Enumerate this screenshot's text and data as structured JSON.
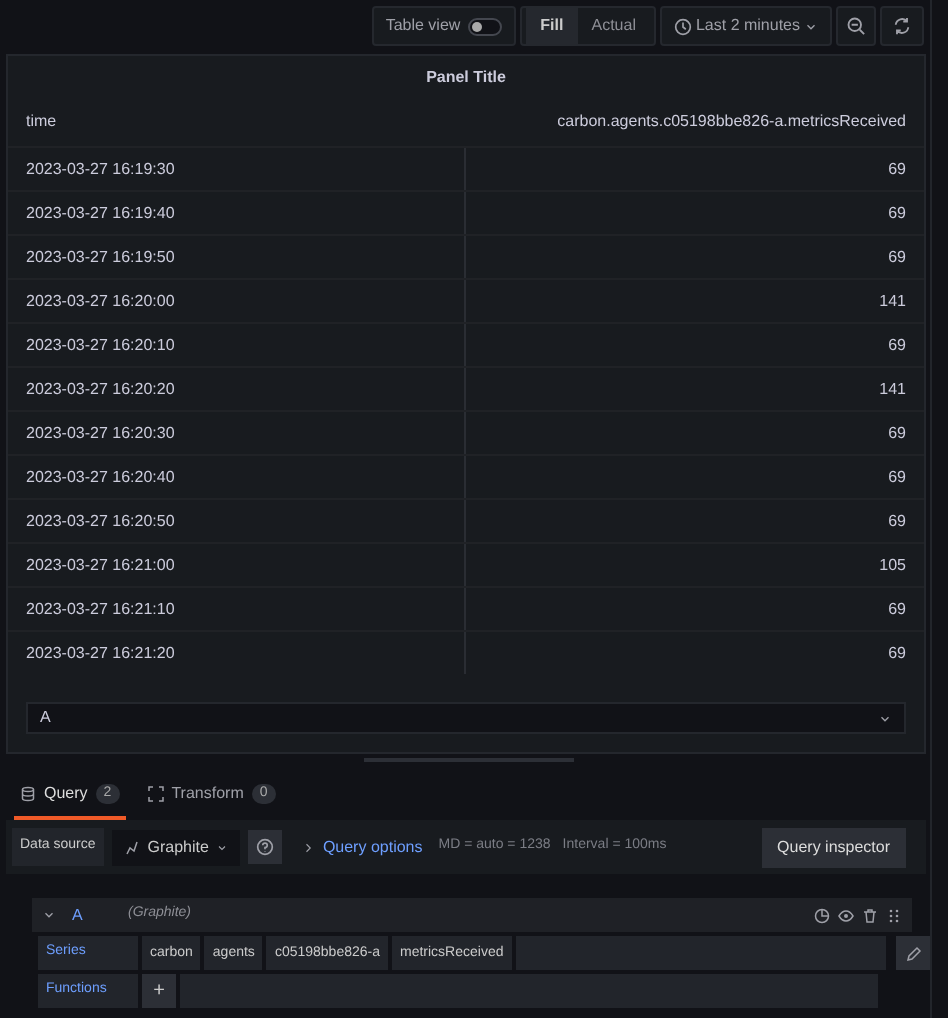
{
  "toolbar": {
    "table_view": {
      "label": "Table view",
      "on": false
    },
    "fill_modes": [
      {
        "label": "Fill",
        "selected": true
      },
      {
        "label": "Actual",
        "selected": false
      }
    ],
    "time_range": "Last 2 minutes"
  },
  "panel": {
    "title": "Panel Title",
    "columns": [
      "time",
      "carbon.agents.c05198bbe826-a.metricsReceived"
    ],
    "rows": [
      [
        "2023-03-27 16:19:30",
        "69"
      ],
      [
        "2023-03-27 16:19:40",
        "69"
      ],
      [
        "2023-03-27 16:19:50",
        "69"
      ],
      [
        "2023-03-27 16:20:00",
        "141"
      ],
      [
        "2023-03-27 16:20:10",
        "69"
      ],
      [
        "2023-03-27 16:20:20",
        "141"
      ],
      [
        "2023-03-27 16:20:30",
        "69"
      ],
      [
        "2023-03-27 16:20:40",
        "69"
      ],
      [
        "2023-03-27 16:20:50",
        "69"
      ],
      [
        "2023-03-27 16:21:00",
        "105"
      ],
      [
        "2023-03-27 16:21:10",
        "69"
      ],
      [
        "2023-03-27 16:21:20",
        "69"
      ]
    ],
    "frame_select": "A"
  },
  "query_tabs": [
    {
      "label": "Query",
      "count": "2",
      "selected": true
    },
    {
      "label": "Transform",
      "count": "0",
      "selected": false
    }
  ],
  "query_bar": {
    "data_source_label": "Data source",
    "data_source": "Graphite",
    "options_link": "Query options",
    "md": "MD = auto = 1238",
    "interval": "Interval = 100ms",
    "inspector_button": "Query inspector"
  },
  "query": {
    "ref": "A",
    "source": "(Graphite)",
    "expanded": true,
    "series_label": "Series",
    "series_segments": [
      "carbon",
      "agents",
      "c05198bbe826-a",
      "metricsReceived"
    ],
    "functions_label": "Functions",
    "add_button": "+"
  }
}
